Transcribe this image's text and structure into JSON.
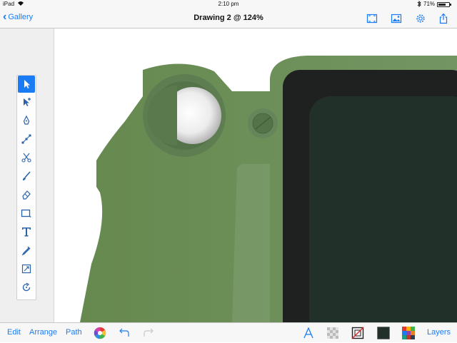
{
  "status_bar": {
    "device": "iPad",
    "time": "2:10 pm",
    "battery_text": "71%",
    "battery_level": 0.71
  },
  "nav": {
    "back_label": "Gallery",
    "title": "Drawing 2 @ 124%",
    "icons": [
      "fit-to-screen-icon",
      "image-icon",
      "gear-icon",
      "share-icon"
    ]
  },
  "tools": [
    {
      "name": "select-tool",
      "active": true
    },
    {
      "name": "subselect-tool",
      "active": false
    },
    {
      "name": "pen-tool",
      "active": false
    },
    {
      "name": "node-tool",
      "active": false
    },
    {
      "name": "scissors-tool",
      "active": false
    },
    {
      "name": "brush-tool",
      "active": false
    },
    {
      "name": "eraser-tool",
      "active": false
    },
    {
      "name": "shape-tool",
      "active": false
    },
    {
      "name": "text-tool",
      "active": false
    },
    {
      "name": "eyedropper-tool",
      "active": false
    },
    {
      "name": "transform-tool",
      "active": false
    },
    {
      "name": "rotate-tool",
      "active": false
    }
  ],
  "bottom_bar": {
    "edit_label": "Edit",
    "arrange_label": "Arrange",
    "path_label": "Path",
    "layers_label": "Layers",
    "fill_color": "#22302a"
  },
  "colors": {
    "accent": "#1a7cf5",
    "body_green": "#6c8f5a",
    "dark_green": "#4f6e46",
    "screen_black": "#1f2121",
    "screen_green": "#22302a"
  }
}
